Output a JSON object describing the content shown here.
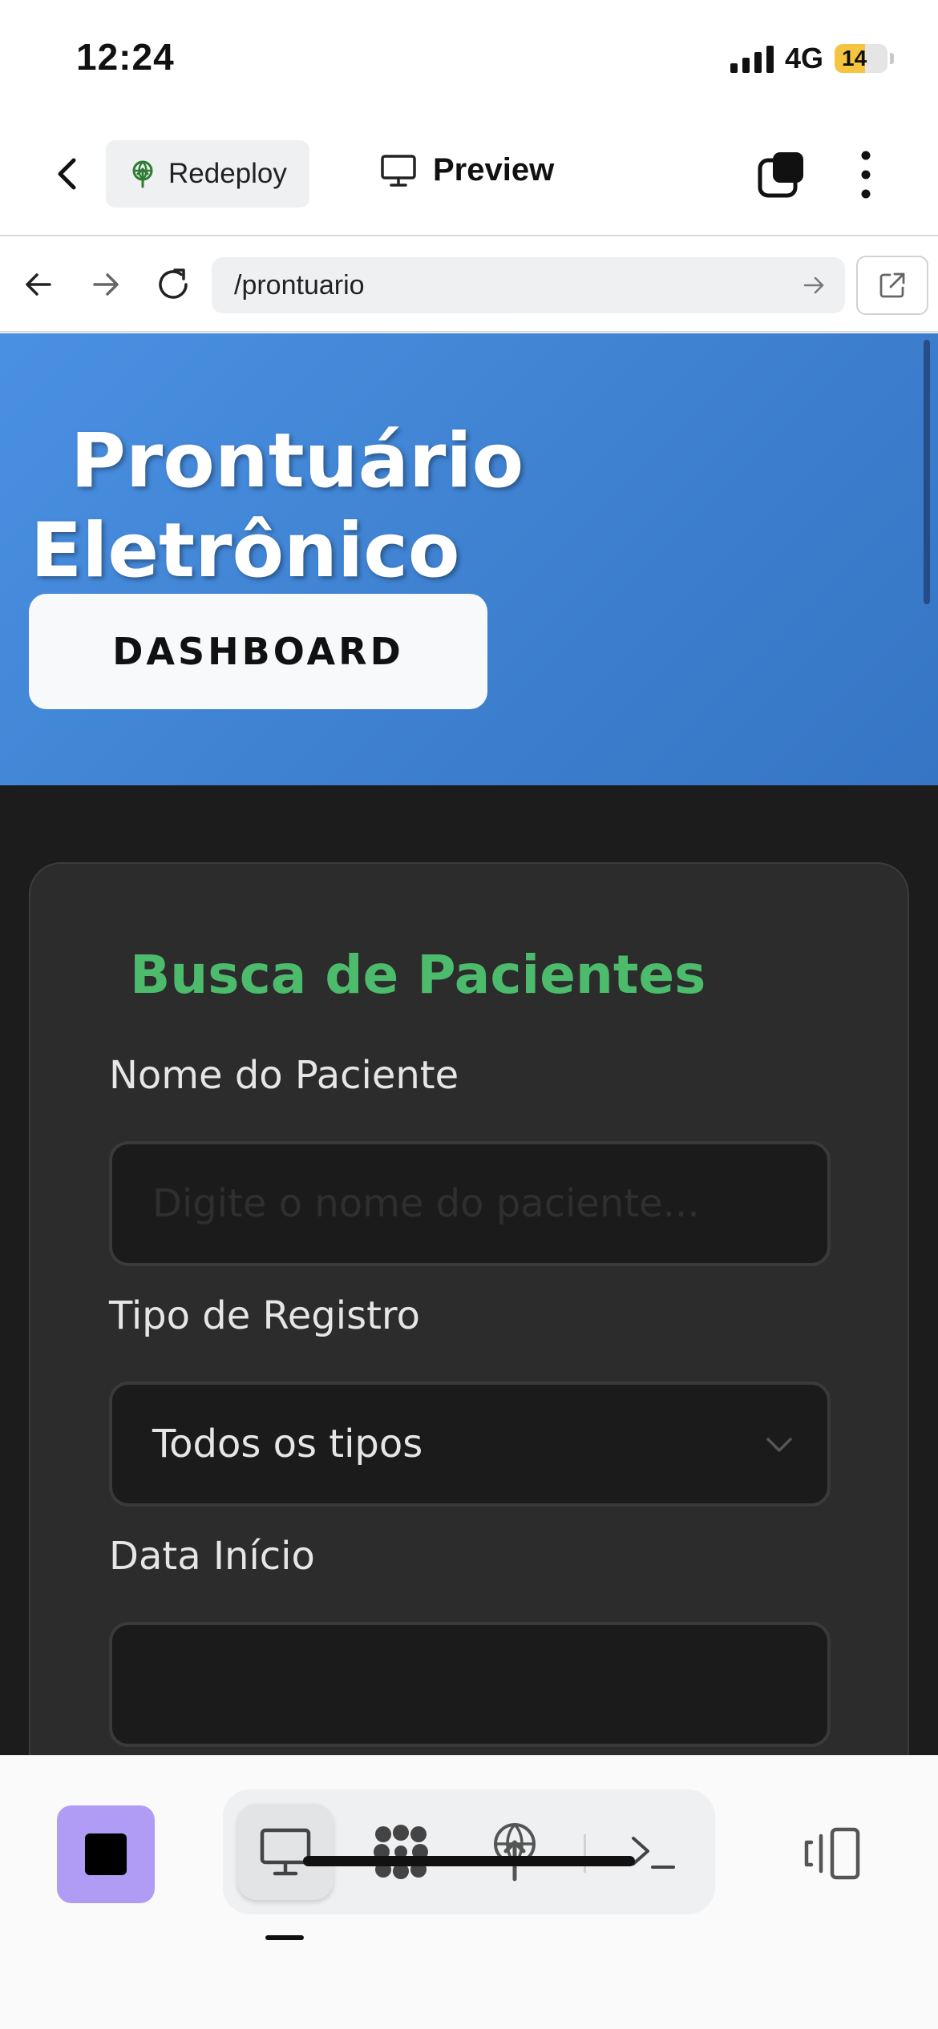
{
  "status_bar": {
    "time": "12:24",
    "network": "4G",
    "battery": "14",
    "battery_color": "#f5c542"
  },
  "app_header": {
    "back_icon": "chevron-left-icon",
    "redeploy_label": "Redeploy",
    "preview_label": "Preview",
    "tabs_icon": "tabs-icon",
    "more_icon": "more-vertical-icon"
  },
  "browser": {
    "url": "/prontuario"
  },
  "page": {
    "hero": {
      "title": "Prontuário Eletrônico",
      "dashboard_label": "DASHBOARD",
      "gradient": [
        "#4a90e2",
        "#3575c4"
      ]
    },
    "search_card": {
      "title": "Busca de Pacientes",
      "title_color": "#4cbb6c",
      "name_label": "Nome do Paciente",
      "name_placeholder": "Digite o nome do paciente...",
      "name_value": "",
      "type_label": "Tipo de Registro",
      "type_selected": "Todos os tipos",
      "date_start_label": "Data Início",
      "date_start_value": ""
    }
  },
  "toolbar": {
    "stop_color": "#b19cf5",
    "tools": [
      "monitor-icon",
      "apps-icon",
      "deploy-icon",
      "terminal-icon"
    ],
    "active_tool": "monitor-icon"
  }
}
